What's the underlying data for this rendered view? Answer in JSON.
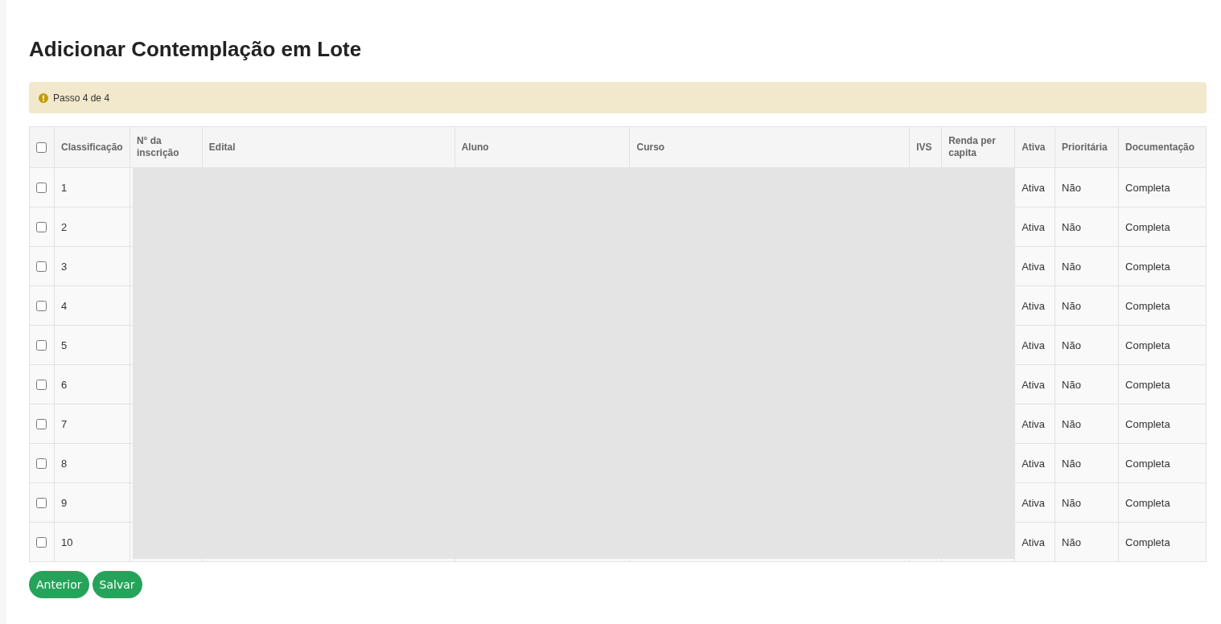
{
  "page": {
    "title": "Adicionar Contemplação em Lote"
  },
  "alert": {
    "text": "Passo 4 de 4"
  },
  "table": {
    "select_all": {
      "checked": false
    },
    "columns": [
      "Classificação",
      "N° da inscrição",
      "Edital",
      "Aluno",
      "Curso",
      "IVS",
      "Renda per capita",
      "Ativa",
      "Prioritária",
      "Documentação"
    ],
    "redacted_overlay": true,
    "rows": [
      {
        "checked": false,
        "classificacao": "1",
        "ativa": "Ativa",
        "prioritaria": "Não",
        "documentacao": "Completa"
      },
      {
        "checked": false,
        "classificacao": "2",
        "ativa": "Ativa",
        "prioritaria": "Não",
        "documentacao": "Completa"
      },
      {
        "checked": false,
        "classificacao": "3",
        "ativa": "Ativa",
        "prioritaria": "Não",
        "documentacao": "Completa"
      },
      {
        "checked": false,
        "classificacao": "4",
        "ativa": "Ativa",
        "prioritaria": "Não",
        "documentacao": "Completa"
      },
      {
        "checked": false,
        "classificacao": "5",
        "ativa": "Ativa",
        "prioritaria": "Não",
        "documentacao": "Completa"
      },
      {
        "checked": false,
        "classificacao": "6",
        "ativa": "Ativa",
        "prioritaria": "Não",
        "documentacao": "Completa"
      },
      {
        "checked": false,
        "classificacao": "7",
        "ativa": "Ativa",
        "prioritaria": "Não",
        "documentacao": "Completa"
      },
      {
        "checked": false,
        "classificacao": "8",
        "ativa": "Ativa",
        "prioritaria": "Não",
        "documentacao": "Completa"
      },
      {
        "checked": false,
        "classificacao": "9",
        "ativa": "Ativa",
        "prioritaria": "Não",
        "documentacao": "Completa"
      },
      {
        "checked": false,
        "classificacao": "10",
        "ativa": "Ativa",
        "prioritaria": "Não",
        "documentacao": "Completa"
      }
    ]
  },
  "buttons": [
    "Anterior",
    "Salvar"
  ]
}
